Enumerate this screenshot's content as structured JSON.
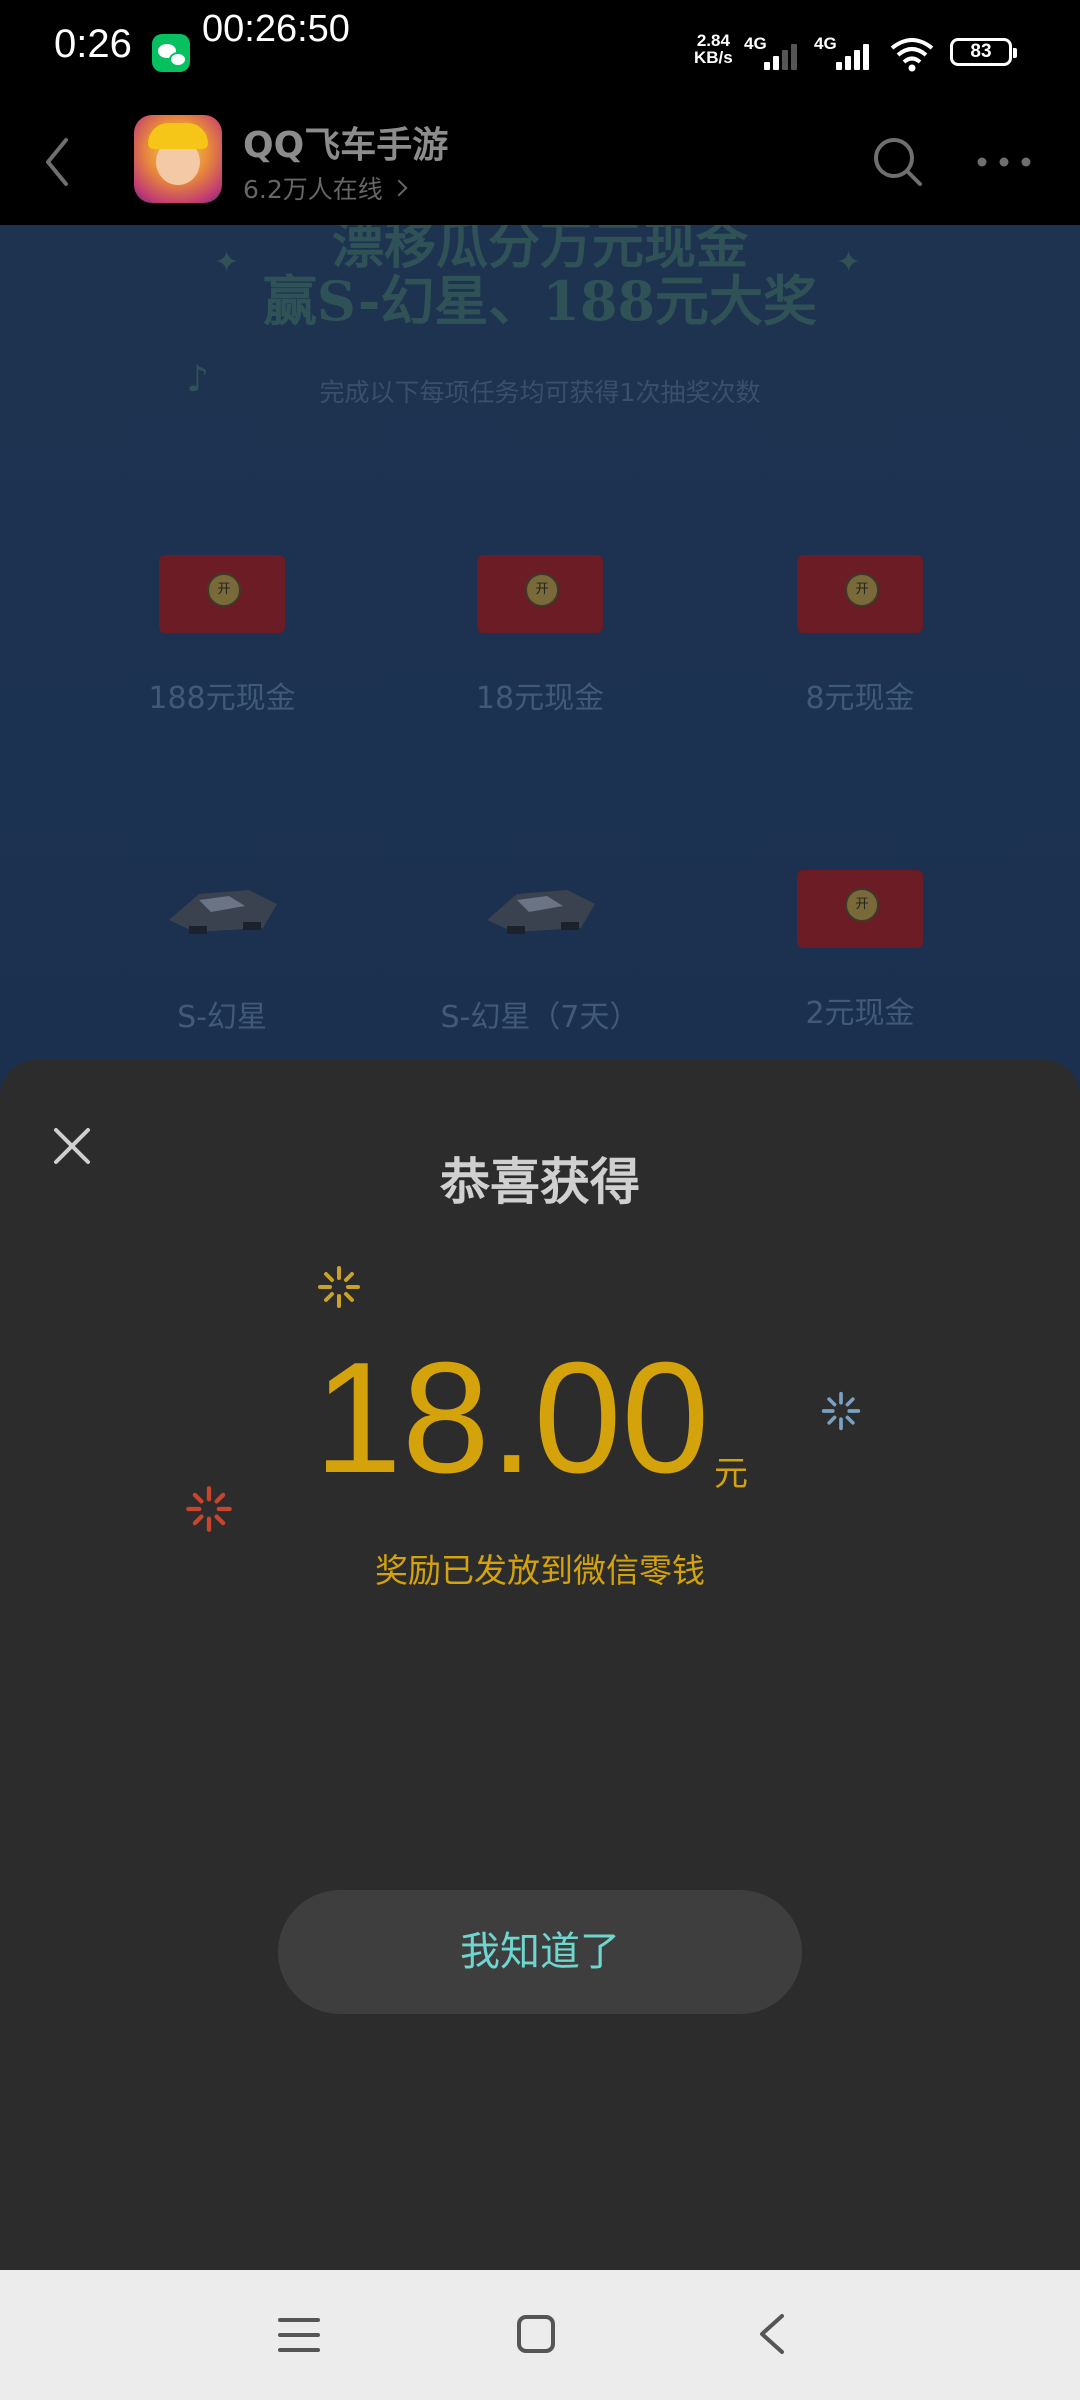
{
  "status_bar": {
    "time": "0:26",
    "timer": "00:26:50",
    "speed_value": "2.84",
    "speed_unit": "KB/s",
    "net1": "4G",
    "net2": "4G",
    "battery": "83"
  },
  "header": {
    "app_name": "QQ飞车手游",
    "online_count": "6.2万人在线"
  },
  "background_page": {
    "title_line1": "漂移瓜分万元现金",
    "title_line2": "赢S-幻星、188元大奖",
    "subtitle": "完成以下每项任务均可获得1次抽奖次数",
    "open_label": "开",
    "prizes": [
      {
        "label": "188元现金",
        "kind": "red-envelope"
      },
      {
        "label": "18元现金",
        "kind": "red-envelope"
      },
      {
        "label": "8元现金",
        "kind": "red-envelope"
      },
      {
        "label": "S-幻星",
        "kind": "car"
      },
      {
        "label": "S-幻星（7天）",
        "kind": "car"
      },
      {
        "label": "2元现金",
        "kind": "red-envelope"
      }
    ]
  },
  "modal": {
    "title": "恭喜获得",
    "amount": "18.00",
    "unit": "元",
    "note": "奖励已发放到微信零钱",
    "confirm_label": "我知道了"
  },
  "colors": {
    "gold": "#d4a20a",
    "button_text": "#6ed6cf",
    "sheet_bg": "#2c2c2c"
  }
}
